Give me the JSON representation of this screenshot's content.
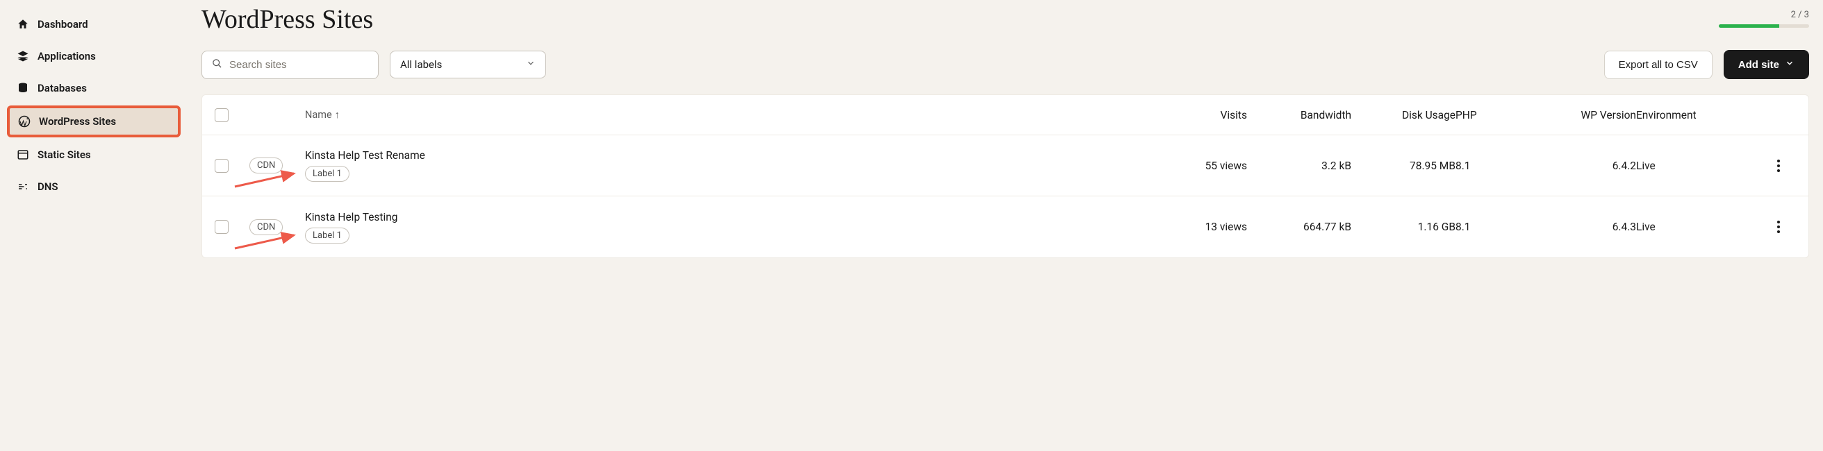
{
  "sidebar": {
    "items": [
      {
        "label": "Dashboard",
        "icon": "home",
        "active": false
      },
      {
        "label": "Applications",
        "icon": "layers",
        "active": false
      },
      {
        "label": "Databases",
        "icon": "database",
        "active": false
      },
      {
        "label": "WordPress Sites",
        "icon": "wordpress",
        "active": true
      },
      {
        "label": "Static Sites",
        "icon": "window",
        "active": false
      },
      {
        "label": "DNS",
        "icon": "dns",
        "active": false
      }
    ]
  },
  "header": {
    "title": "WordPress Sites",
    "progress": {
      "label": "2 / 3",
      "value": 2,
      "max": 3
    }
  },
  "toolbar": {
    "search_placeholder": "Search sites",
    "labels_dropdown": "All labels",
    "export_label": "Export all to CSV",
    "add_label": "Add site"
  },
  "table": {
    "columns": {
      "name": "Name",
      "sort": "↑",
      "visits": "Visits",
      "bandwidth": "Bandwidth",
      "disk": "Disk Usage",
      "php": "PHP",
      "wp": "WP Version",
      "env": "Environment"
    },
    "rows": [
      {
        "cdn": "CDN",
        "name": "Kinsta Help Test Rename",
        "label": "Label 1",
        "visits": "55 views",
        "bandwidth": "3.2 kB",
        "disk": "78.95 MB",
        "php": "8.1",
        "wp": "6.4.2",
        "env": "Live"
      },
      {
        "cdn": "CDN",
        "name": "Kinsta Help Testing",
        "label": "Label 1",
        "visits": "13 views",
        "bandwidth": "664.77 kB",
        "disk": "1.16 GB",
        "php": "8.1",
        "wp": "6.4.3",
        "env": "Live"
      }
    ]
  }
}
